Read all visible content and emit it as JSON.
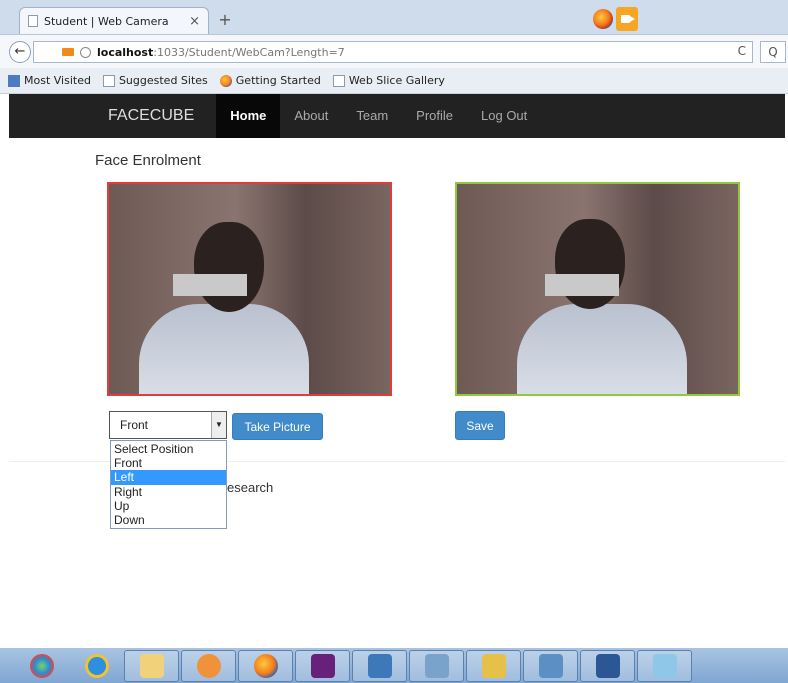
{
  "browser": {
    "tab_title": "Student | Web Camera",
    "tab_close": "×",
    "new_tab": "+",
    "url_host": "localhost",
    "url_path": ":1033/Student/WebCam?Length=7",
    "reload": "C",
    "search": "Q",
    "back": "←",
    "bookmarks": [
      "Most Visited",
      "Suggested Sites",
      "Getting Started",
      "Web Slice Gallery"
    ]
  },
  "site": {
    "brand": "FACECUBE",
    "nav": [
      "Home",
      "About",
      "Team",
      "Profile",
      "Log Out"
    ],
    "active_nav": "Home"
  },
  "page": {
    "heading": "Face Enrolment",
    "position_select": {
      "value": "Front",
      "options": [
        "Select Position",
        "Front",
        "Left",
        "Right",
        "Up",
        "Down"
      ],
      "highlighted": "Left"
    },
    "take_picture_label": "Take Picture",
    "save_label": "Save",
    "partial_text": "esearch"
  },
  "taskbar": {
    "icons": [
      "windows-start",
      "internet-explorer",
      "file-explorer",
      "media-player",
      "firefox",
      "visual-studio",
      "control-panel",
      "network",
      "paint",
      "tools",
      "microsoft-word",
      "notepad"
    ]
  },
  "colors": {
    "live_frame_border": "#e23b3b",
    "snapshot_frame_border": "#92c83e",
    "primary_button": "#428bca",
    "navbar_bg": "#222222",
    "dropdown_highlight": "#3399ff"
  }
}
